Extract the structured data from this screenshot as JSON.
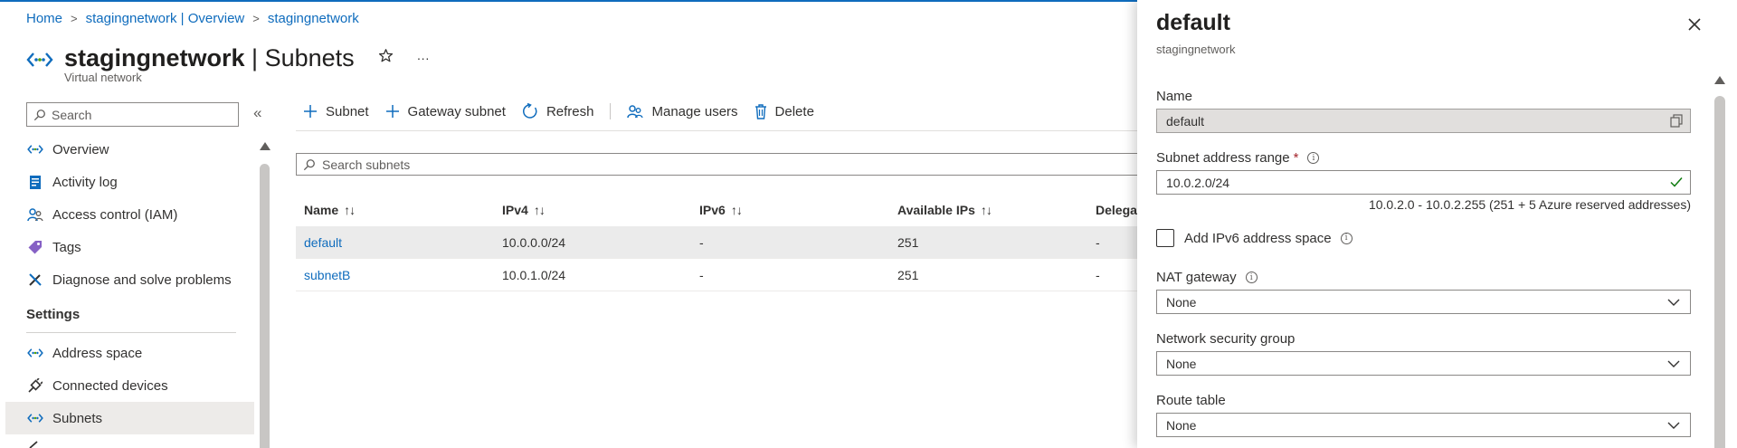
{
  "breadcrumb": {
    "items": [
      "Home",
      "stagingnetwork | Overview",
      "stagingnetwork"
    ]
  },
  "header": {
    "resource_name": "stagingnetwork",
    "separator": " | ",
    "blade_name": "Subnets",
    "subtitle": "Virtual network",
    "more_label": "···"
  },
  "sidebar": {
    "search_placeholder": "Search",
    "collapse_label": "«",
    "items": [
      {
        "label": "Overview",
        "icon": "network-icon"
      },
      {
        "label": "Activity log",
        "icon": "log-icon"
      },
      {
        "label": "Access control (IAM)",
        "icon": "people-icon"
      },
      {
        "label": "Tags",
        "icon": "tag-icon"
      },
      {
        "label": "Diagnose and solve problems",
        "icon": "wrench-icon"
      }
    ],
    "section_settings": "Settings",
    "settings_items": [
      {
        "label": "Address space",
        "icon": "network-icon"
      },
      {
        "label": "Connected devices",
        "icon": "plug-icon"
      },
      {
        "label": "Subnets",
        "icon": "network-icon",
        "active": true
      }
    ]
  },
  "toolbar": {
    "subnet_label": "Subnet",
    "gateway_subnet_label": "Gateway subnet",
    "refresh_label": "Refresh",
    "manage_users_label": "Manage users",
    "delete_label": "Delete"
  },
  "grid": {
    "search_placeholder": "Search subnets",
    "columns": [
      "Name",
      "IPv4",
      "IPv6",
      "Available IPs",
      "Delega"
    ],
    "sort_glyph": "↑↓",
    "rows": [
      {
        "name": "default",
        "ipv4": "10.0.0.0/24",
        "ipv6": "-",
        "available": "251",
        "delegated": "-",
        "selected": true
      },
      {
        "name": "subnetB",
        "ipv4": "10.0.1.0/24",
        "ipv6": "-",
        "available": "251",
        "delegated": "-",
        "selected": false
      }
    ]
  },
  "panel": {
    "title": "default",
    "subtitle": "stagingnetwork",
    "name_label": "Name",
    "name_value": "default",
    "range_label": "Subnet address range",
    "range_required": "*",
    "range_value": "10.0.2.0/24",
    "range_hint": "10.0.2.0 - 10.0.2.255 (251 + 5 Azure reserved addresses)",
    "ipv6_label": "Add IPv6 address space",
    "nat_label": "NAT gateway",
    "nat_value": "None",
    "nsg_label": "Network security group",
    "nsg_value": "None",
    "route_label": "Route table",
    "route_value": "None",
    "info_glyph": "i"
  },
  "colors": {
    "accent": "#0f6cbd",
    "selected_row": "#ebebeb",
    "valid_check": "#107c10"
  }
}
